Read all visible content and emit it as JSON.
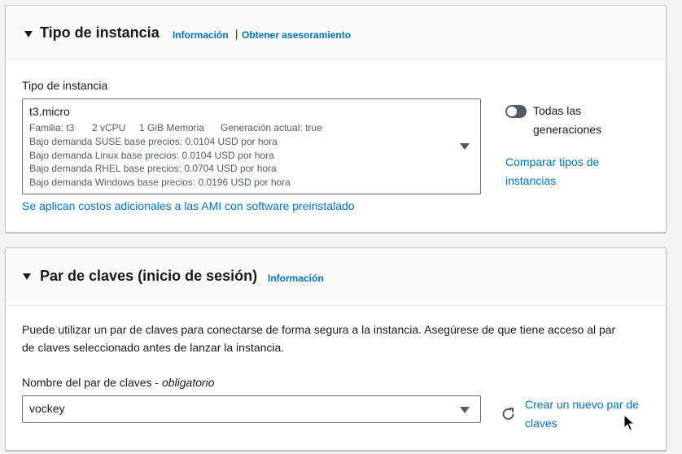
{
  "instance_section": {
    "title": "Tipo de instancia",
    "info_link": "Información",
    "separator": "|",
    "advice_link": "Obtener asesoramiento",
    "field_label": "Tipo de instancia",
    "selected": {
      "name": "t3.micro",
      "family": "Familia: t3",
      "vcpu": "2 vCPU",
      "memory": "1 GiB Memoria",
      "generation": "Generación actual: true",
      "price_suse": "Bajo demanda SUSE base precios: 0.0104 USD por hora",
      "price_linux": "Bajo demanda Linux base precios: 0.0104 USD por hora",
      "price_rhel": "Bajo demanda RHEL base precios: 0.0704 USD por hora",
      "price_windows": "Bajo demanda Windows base precios: 0.0196 USD por hora"
    },
    "toggle_label_line1": "Todas las",
    "toggle_label_line2": "generaciones",
    "toggle_on": false,
    "compare_link_line1": "Comparar tipos de",
    "compare_link_line2": "instancias",
    "ami_link": "Se aplican costos adicionales a las AMI con software preinstalado"
  },
  "keypair_section": {
    "title": "Par de claves (inicio de sesión)",
    "info_link": "Información",
    "description_line1": "Puede utilizar un par de claves para conectarse de forma segura a la instancia. Asegúrese de que tiene acceso al par",
    "description_line2": "de claves seleccionado antes de lanzar la instancia.",
    "field_label": "Nombre del par de claves - ",
    "field_required": "obligatorio",
    "selected": "vockey",
    "create_link_line1": "Crear un nuevo par de",
    "create_link_line2": "claves"
  },
  "colors": {
    "link": "#0073bb",
    "text": "#16191f",
    "secondary_text": "#545b64",
    "toggle_off": "#545b64"
  }
}
